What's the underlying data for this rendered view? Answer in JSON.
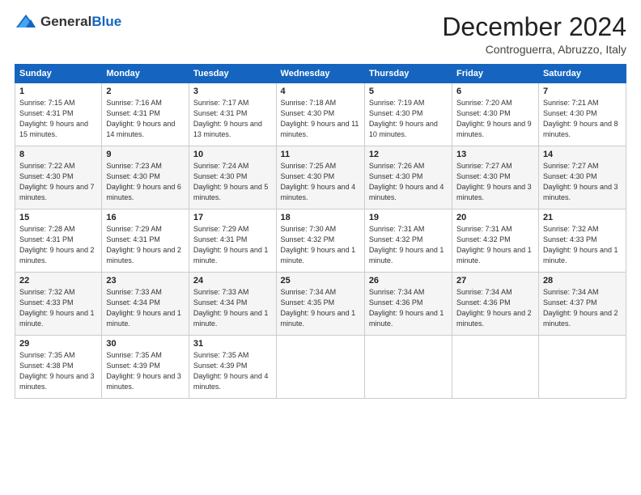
{
  "header": {
    "logo_general": "General",
    "logo_blue": "Blue",
    "month_title": "December 2024",
    "location": "Controguerra, Abruzzo, Italy"
  },
  "days_of_week": [
    "Sunday",
    "Monday",
    "Tuesday",
    "Wednesday",
    "Thursday",
    "Friday",
    "Saturday"
  ],
  "weeks": [
    [
      {
        "day": "1",
        "info": "Sunrise: 7:15 AM\nSunset: 4:31 PM\nDaylight: 9 hours and 15 minutes."
      },
      {
        "day": "2",
        "info": "Sunrise: 7:16 AM\nSunset: 4:31 PM\nDaylight: 9 hours and 14 minutes."
      },
      {
        "day": "3",
        "info": "Sunrise: 7:17 AM\nSunset: 4:31 PM\nDaylight: 9 hours and 13 minutes."
      },
      {
        "day": "4",
        "info": "Sunrise: 7:18 AM\nSunset: 4:30 PM\nDaylight: 9 hours and 11 minutes."
      },
      {
        "day": "5",
        "info": "Sunrise: 7:19 AM\nSunset: 4:30 PM\nDaylight: 9 hours and 10 minutes."
      },
      {
        "day": "6",
        "info": "Sunrise: 7:20 AM\nSunset: 4:30 PM\nDaylight: 9 hours and 9 minutes."
      },
      {
        "day": "7",
        "info": "Sunrise: 7:21 AM\nSunset: 4:30 PM\nDaylight: 9 hours and 8 minutes."
      }
    ],
    [
      {
        "day": "8",
        "info": "Sunrise: 7:22 AM\nSunset: 4:30 PM\nDaylight: 9 hours and 7 minutes."
      },
      {
        "day": "9",
        "info": "Sunrise: 7:23 AM\nSunset: 4:30 PM\nDaylight: 9 hours and 6 minutes."
      },
      {
        "day": "10",
        "info": "Sunrise: 7:24 AM\nSunset: 4:30 PM\nDaylight: 9 hours and 5 minutes."
      },
      {
        "day": "11",
        "info": "Sunrise: 7:25 AM\nSunset: 4:30 PM\nDaylight: 9 hours and 4 minutes."
      },
      {
        "day": "12",
        "info": "Sunrise: 7:26 AM\nSunset: 4:30 PM\nDaylight: 9 hours and 4 minutes."
      },
      {
        "day": "13",
        "info": "Sunrise: 7:27 AM\nSunset: 4:30 PM\nDaylight: 9 hours and 3 minutes."
      },
      {
        "day": "14",
        "info": "Sunrise: 7:27 AM\nSunset: 4:30 PM\nDaylight: 9 hours and 3 minutes."
      }
    ],
    [
      {
        "day": "15",
        "info": "Sunrise: 7:28 AM\nSunset: 4:31 PM\nDaylight: 9 hours and 2 minutes."
      },
      {
        "day": "16",
        "info": "Sunrise: 7:29 AM\nSunset: 4:31 PM\nDaylight: 9 hours and 2 minutes."
      },
      {
        "day": "17",
        "info": "Sunrise: 7:29 AM\nSunset: 4:31 PM\nDaylight: 9 hours and 1 minute."
      },
      {
        "day": "18",
        "info": "Sunrise: 7:30 AM\nSunset: 4:32 PM\nDaylight: 9 hours and 1 minute."
      },
      {
        "day": "19",
        "info": "Sunrise: 7:31 AM\nSunset: 4:32 PM\nDaylight: 9 hours and 1 minute."
      },
      {
        "day": "20",
        "info": "Sunrise: 7:31 AM\nSunset: 4:32 PM\nDaylight: 9 hours and 1 minute."
      },
      {
        "day": "21",
        "info": "Sunrise: 7:32 AM\nSunset: 4:33 PM\nDaylight: 9 hours and 1 minute."
      }
    ],
    [
      {
        "day": "22",
        "info": "Sunrise: 7:32 AM\nSunset: 4:33 PM\nDaylight: 9 hours and 1 minute."
      },
      {
        "day": "23",
        "info": "Sunrise: 7:33 AM\nSunset: 4:34 PM\nDaylight: 9 hours and 1 minute."
      },
      {
        "day": "24",
        "info": "Sunrise: 7:33 AM\nSunset: 4:34 PM\nDaylight: 9 hours and 1 minute."
      },
      {
        "day": "25",
        "info": "Sunrise: 7:34 AM\nSunset: 4:35 PM\nDaylight: 9 hours and 1 minute."
      },
      {
        "day": "26",
        "info": "Sunrise: 7:34 AM\nSunset: 4:36 PM\nDaylight: 9 hours and 1 minute."
      },
      {
        "day": "27",
        "info": "Sunrise: 7:34 AM\nSunset: 4:36 PM\nDaylight: 9 hours and 2 minutes."
      },
      {
        "day": "28",
        "info": "Sunrise: 7:34 AM\nSunset: 4:37 PM\nDaylight: 9 hours and 2 minutes."
      }
    ],
    [
      {
        "day": "29",
        "info": "Sunrise: 7:35 AM\nSunset: 4:38 PM\nDaylight: 9 hours and 3 minutes."
      },
      {
        "day": "30",
        "info": "Sunrise: 7:35 AM\nSunset: 4:39 PM\nDaylight: 9 hours and 3 minutes."
      },
      {
        "day": "31",
        "info": "Sunrise: 7:35 AM\nSunset: 4:39 PM\nDaylight: 9 hours and 4 minutes."
      },
      {
        "day": "",
        "info": ""
      },
      {
        "day": "",
        "info": ""
      },
      {
        "day": "",
        "info": ""
      },
      {
        "day": "",
        "info": ""
      }
    ]
  ]
}
